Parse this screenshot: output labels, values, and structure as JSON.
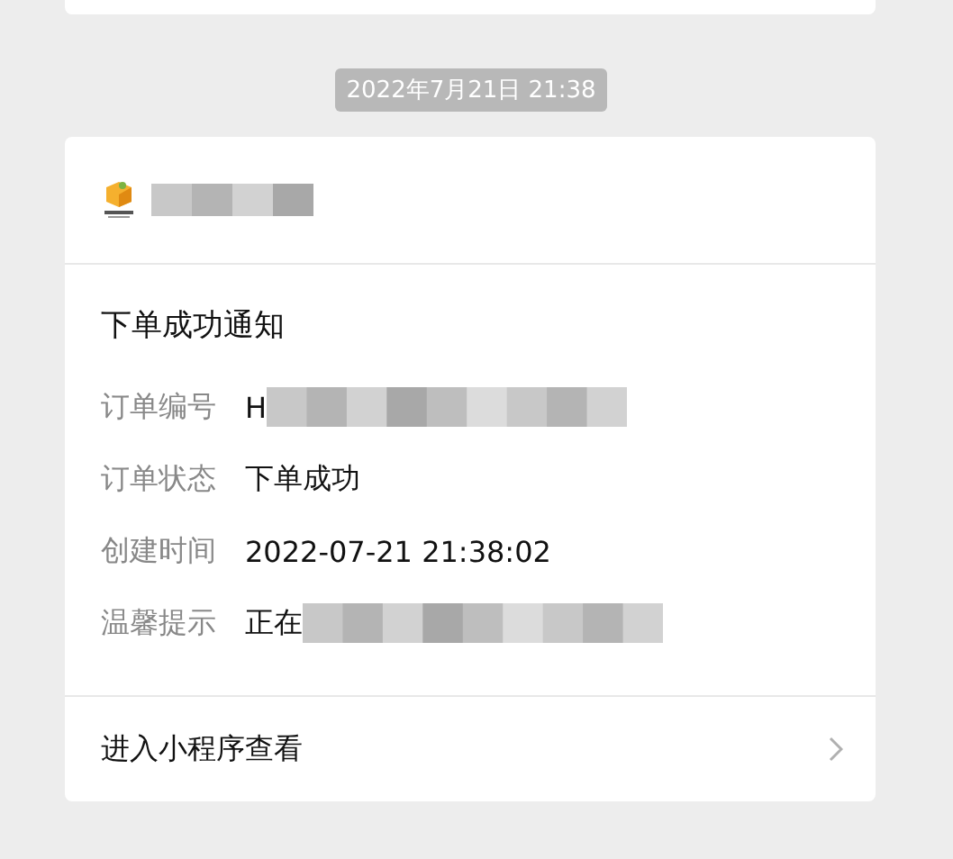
{
  "timestamp": "2022年7月21日 21:38",
  "card": {
    "header": {
      "name_redacted": true
    },
    "title": "下单成功通知",
    "fields": [
      {
        "label": "订单编号",
        "value": "H",
        "redacted": true
      },
      {
        "label": "订单状态",
        "value": "下单成功",
        "redacted": false
      },
      {
        "label": "创建时间",
        "value": "2022-07-21 21:38:02",
        "redacted": false
      },
      {
        "label": "温馨提示",
        "value": "正在",
        "redacted": true
      }
    ],
    "footer": {
      "link": "进入小程序查看"
    }
  }
}
